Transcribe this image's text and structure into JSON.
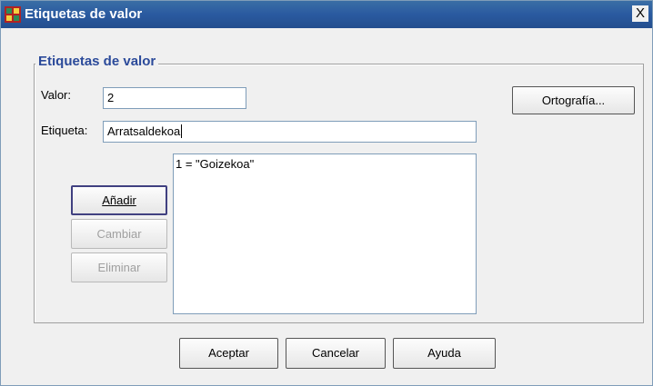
{
  "window": {
    "title": "Etiquetas de valor",
    "close_symbol": "X"
  },
  "group": {
    "title": "Etiquetas de valor"
  },
  "valor": {
    "label": "Valor:",
    "value": "2"
  },
  "etiqueta": {
    "label": "Etiqueta:",
    "value": "Arratsaldekoa"
  },
  "buttons": {
    "ortografia": "Ortografía...",
    "anadir": "Añadir",
    "cambiar": "Cambiar",
    "eliminar": "Eliminar",
    "aceptar": "Aceptar",
    "cancelar": "Cancelar",
    "ayuda": "Ayuda"
  },
  "list": {
    "items": [
      "1 = \"Goizekoa\""
    ]
  }
}
